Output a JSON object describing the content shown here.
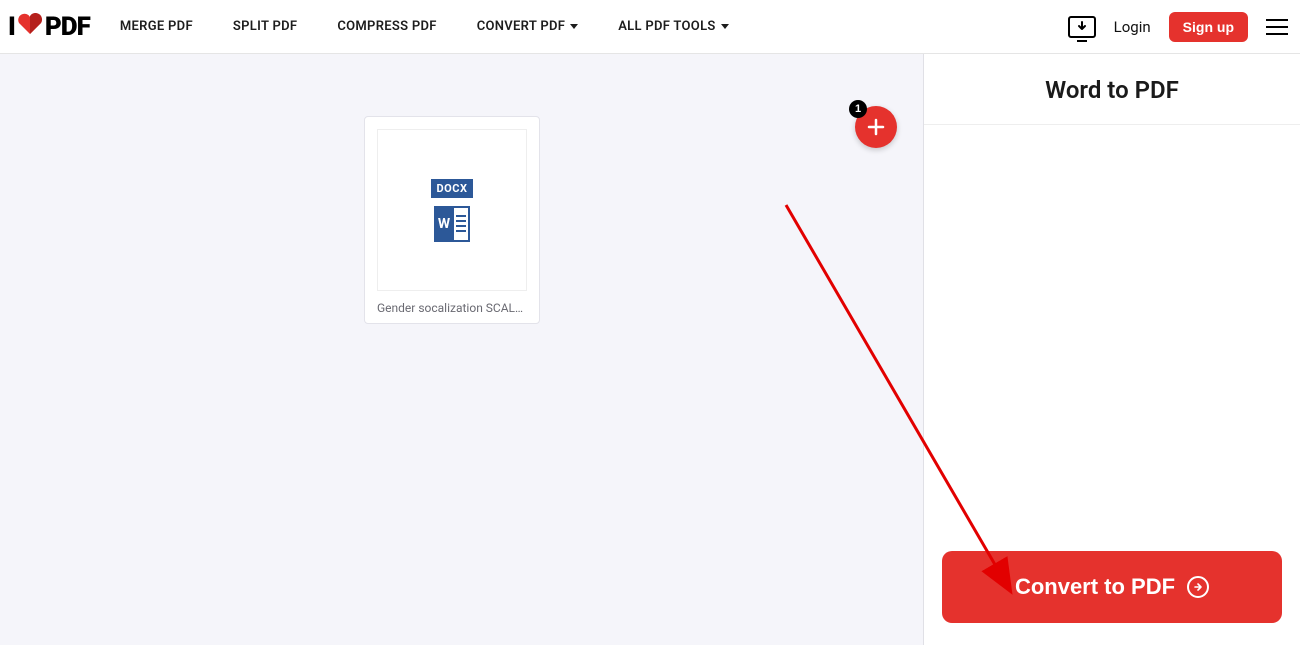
{
  "logo": {
    "part1": "I",
    "part2": "PDF"
  },
  "nav": {
    "merge": "MERGE PDF",
    "split": "SPLIT PDF",
    "compress": "COMPRESS PDF",
    "convert": "CONVERT PDF",
    "all": "ALL PDF TOOLS"
  },
  "header": {
    "login": "Login",
    "signup": "Sign up"
  },
  "sidebar": {
    "title": "Word to PDF",
    "convert_label": "Convert to PDF"
  },
  "file": {
    "badge": "DOCX",
    "icon_letter": "W",
    "name": "Gender socalization SCALE (..."
  },
  "add": {
    "count": "1"
  },
  "colors": {
    "accent": "#e5322d",
    "word_blue": "#2c5898"
  }
}
